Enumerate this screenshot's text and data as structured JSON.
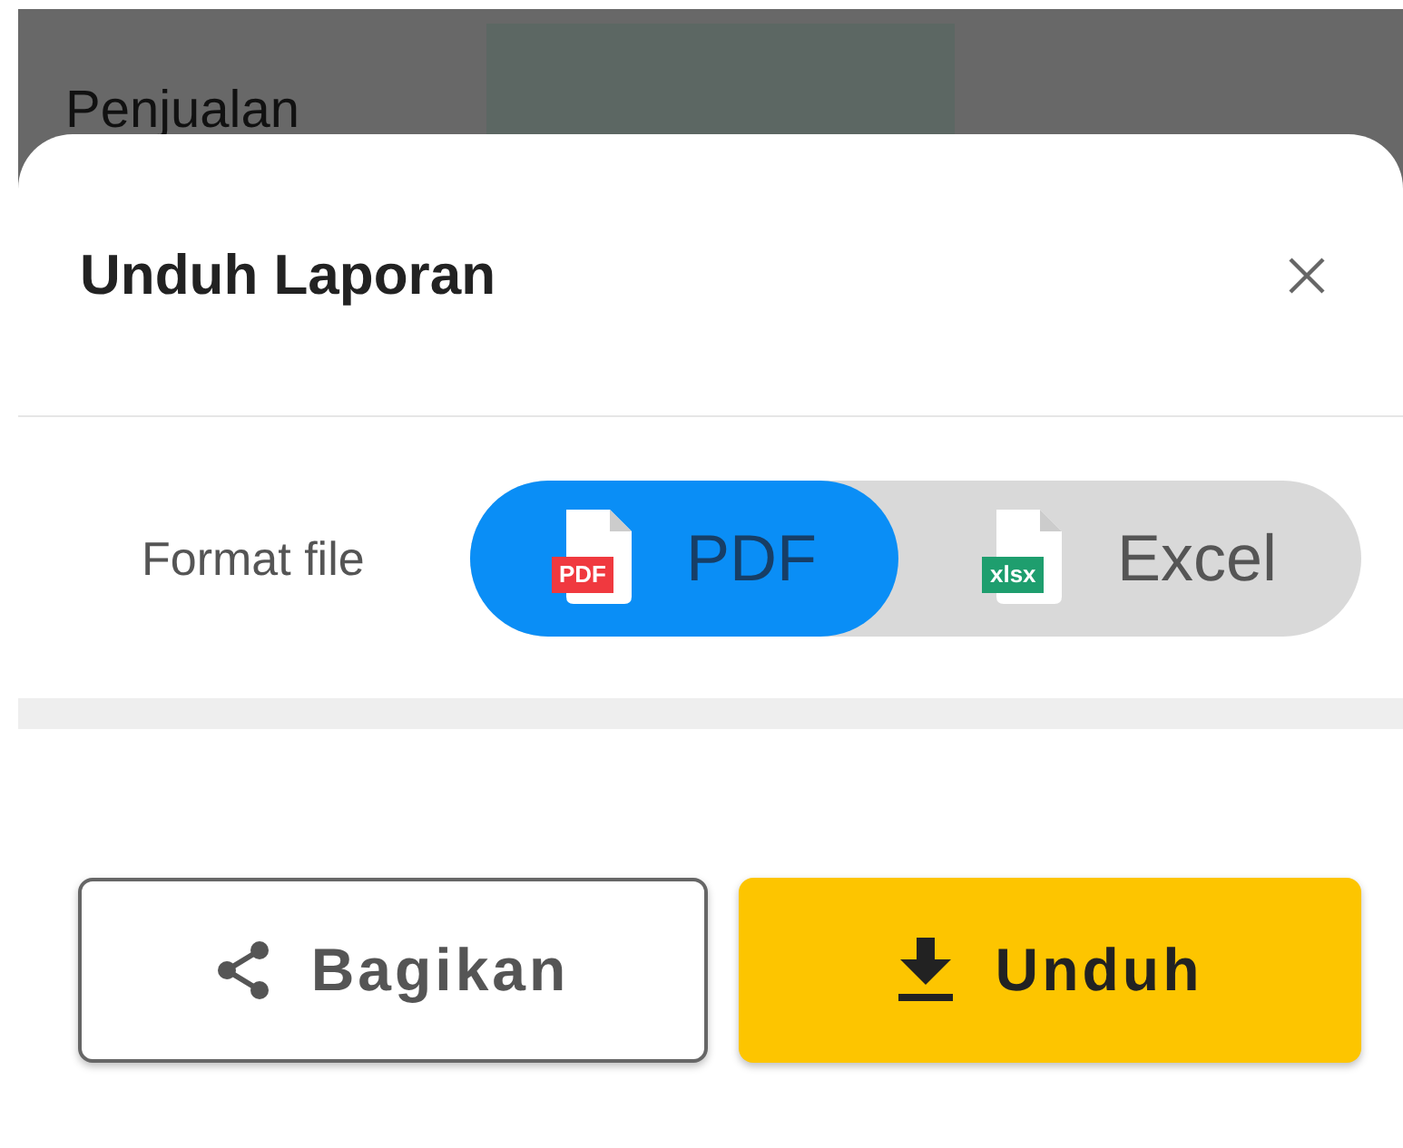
{
  "background": {
    "row_label": "Penjualan"
  },
  "sheet": {
    "title": "Unduh Laporan",
    "format_label": "Format file",
    "formats": [
      {
        "label": "PDF",
        "badge": "PDF",
        "color": "#f0393f",
        "selected": true
      },
      {
        "label": "Excel",
        "badge": "xlsx",
        "color": "#1e9e6e",
        "selected": false
      }
    ],
    "buttons": [
      {
        "label": "Bagikan",
        "kind": "share"
      },
      {
        "label": "Unduh",
        "kind": "download"
      }
    ]
  }
}
